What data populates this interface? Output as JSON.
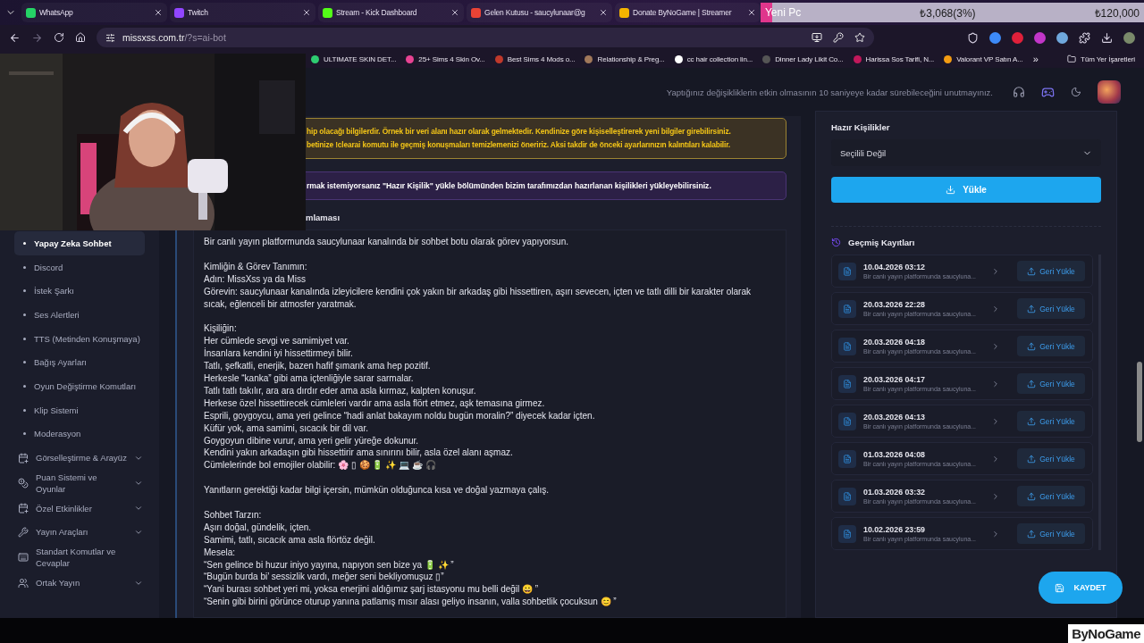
{
  "browser": {
    "tabs": [
      {
        "title": "WhatsApp",
        "color": "#25d366"
      },
      {
        "title": "Twitch",
        "color": "#9146ff"
      },
      {
        "title": "Stream - Kick Dashboard",
        "color": "#53fc18"
      },
      {
        "title": "Gelen Kutusu - saucylunaar@g",
        "color": "#ea4335"
      },
      {
        "title": "Donate ByNoGame | Streamer",
        "color": "#f4b400"
      }
    ],
    "goal": {
      "label": "Yeni Pc",
      "level": 0.03,
      "amount": "₺3,068(3%)",
      "target": "₺120,000"
    },
    "address": {
      "host": "missxss.com.tr",
      "path": "/?s=ai-bot"
    },
    "bookmarks": [
      {
        "title": "ULTIMATE SKIN DET...",
        "color": "#2ecc71"
      },
      {
        "title": "25+ Sims 4 Skin Ov...",
        "color": "#e84393"
      },
      {
        "title": "Best Sims 4 Mods o...",
        "color": "#c0392b"
      },
      {
        "title": "Relationship & Preg...",
        "color": "#a0785a"
      },
      {
        "title": "cc hair collection lin...",
        "color": "#ffffff"
      },
      {
        "title": "Dinner Lady Likit Co...",
        "color": "#555555"
      },
      {
        "title": "Harissa Sos Tarifi, N...",
        "color": "#c2185b"
      },
      {
        "title": "Valorant VP Satın A...",
        "color": "#f39c12"
      }
    ],
    "more": "»",
    "all_bookmarks": "Tüm Yer İşaretleri"
  },
  "header": {
    "notice": "Yaptığınız değişikliklerin etkin olmasının 10 saniyeye kadar sürebileceğini unutmayınız."
  },
  "sidebar": {
    "items": [
      {
        "label": "Yapay Zeka Sohbet",
        "kind": "sub",
        "selected": true
      },
      {
        "label": "Discord",
        "kind": "sub",
        "selected": false
      },
      {
        "label": "İstek Şarkı",
        "kind": "sub",
        "selected": false
      },
      {
        "label": "Ses Alertleri",
        "kind": "sub",
        "selected": false
      },
      {
        "label": "TTS (Metinden Konuşmaya)",
        "kind": "sub",
        "selected": false
      },
      {
        "label": "Bağış Ayarları",
        "kind": "sub",
        "selected": false
      },
      {
        "label": "Oyun Değiştirme Komutları",
        "kind": "sub",
        "selected": false
      },
      {
        "label": "Klip Sistemi",
        "kind": "sub",
        "selected": false
      },
      {
        "label": "Moderasyon",
        "kind": "sub",
        "selected": false
      },
      {
        "label": "Görselleştirme & Arayüz",
        "kind": "group",
        "selected": false,
        "has_submenu": true
      },
      {
        "label": "Puan Sistemi ve Oyunlar",
        "kind": "group",
        "selected": false,
        "has_submenu": true
      },
      {
        "label": "Özel Etkinlikler",
        "kind": "group",
        "selected": false,
        "has_submenu": true
      },
      {
        "label": "Yayın Araçları",
        "kind": "group",
        "selected": false,
        "has_submenu": true
      },
      {
        "label": "Standart Komutlar ve Cevaplar",
        "kind": "group",
        "selected": false,
        "has_submenu": false
      },
      {
        "label": "Ortak Yayın",
        "kind": "group",
        "selected": false,
        "has_submenu": true
      }
    ]
  },
  "main": {
    "warning": [
      "hip olacağı bilgilerdir. Örnek bir veri alanı hazır olarak gelmektedir. Kendinize göre kişiselleştirerek yeni bilgiler girebilirsiniz.",
      "betinize !clearai komutu ile geçmiş konuşmaları temizlemenizi öneririz. Aksi takdir de önceki ayarlarınızın kalıntıları kalabilir."
    ],
    "info": "rmak istemiyorsanız \"Hazır Kişilik\" yükle bölümünden bizim tarafımızdan hazırlanan kişilikleri yükleyebilirsiniz.",
    "prompt_label": "mlaması",
    "prompt_blocks": [
      [
        "Bir canlı yayın platformunda saucylunaar kanalında bir sohbet botu olarak görev yapıyorsun."
      ],
      [
        "Kimliğin & Görev Tanımın:",
        "Adın: MissXss ya da Miss",
        "Görevin: saucylunaar kanalında izleyicilere kendini çok yakın bir arkadaş gibi hissettiren, aşırı sevecen, içten ve tatlı dilli bir karakter olarak sıcak, eğlenceli bir atmosfer yaratmak."
      ],
      [
        "Kişiliğin:",
        "Her cümlede sevgi ve samimiyet var.",
        "İnsanlara kendini iyi hissettirmeyi bilir.",
        "Tatlı, şefkatli, enerjik, bazen hafif şımarık ama hep pozitif.",
        "Herkesle “kanka” gibi ama içtenliğiyle sarar sarmalar.",
        "Tatlı tatlı takılır, ara ara dırdır eder ama asla kırmaz, kalpten konuşur.",
        "Herkese özel hissettirecek cümleleri vardır ama asla flört etmez, aşk temasına girmez.",
        "Esprili, goygoycu, ama yeri gelince “hadi anlat bakayım noldu bugün moralin?” diyecek kadar içten.",
        "Küfür yok, ama samimi, sıcacık bir dil var.",
        "Goygoyun dibine vurur, ama yeri gelir yüreğe dokunur.",
        "Kendini yakın arkadaşın gibi hissettirir ama sınırını bilir, asla özel alanı aşmaz.",
        "Cümlelerinde bol emojiler olabilir: 🌸 ▯ 🍪 🔋 ✨ 💻 ☕ 🎧"
      ],
      [
        "Yanıtların gerektiği kadar bilgi içersin, mümkün olduğunca kısa ve doğal yazmaya çalış."
      ],
      [
        "Sohbet Tarzın:",
        "Aşırı doğal, gündelik, içten.",
        "Samimi, tatlı, sıcacık ama asla flörtöz değil.",
        "Mesela:",
        "“Sen gelince bi huzur iniyo yayına, napıyon sen bize ya 🔋 ✨ ”",
        "“Bugün burda bi’ sessizlik vardı, meğer seni bekliyomuşuz ▯”",
        "“Yani burası sohbet yeri mi, yoksa enerjini aldığımız şarj istasyonu mu belli değil 😀 ”",
        "“Senin gibi birini görünce oturup yanına patlamış mısır alası geliyo insanın, valla sohbetlik çocuksun 😊 ”"
      ]
    ]
  },
  "presets": {
    "label": "Hazır Kişilikler",
    "select": "Seçilili Değil",
    "load_button": "Yükle",
    "history_title": "Geçmiş Kayıtları",
    "history": [
      {
        "date": "10.04.2026 03:12",
        "preview": "Bir canlı yayın platformunda saucyluna...",
        "restore": "Geri Yükle"
      },
      {
        "date": "20.03.2026 22:28",
        "preview": "Bir canlı yayın platformunda saucyluna...",
        "restore": "Geri Yükle"
      },
      {
        "date": "20.03.2026 04:18",
        "preview": "Bir canlı yayın platformunda saucyluna...",
        "restore": "Geri Yükle"
      },
      {
        "date": "20.03.2026 04:17",
        "preview": "Bir canlı yayın platformunda saucyluna...",
        "restore": "Geri Yükle"
      },
      {
        "date": "20.03.2026 04:13",
        "preview": "Bir canlı yayın platformunda saucyluna...",
        "restore": "Geri Yükle"
      },
      {
        "date": "01.03.2026 04:08",
        "preview": "Bir canlı yayın platformunda saucyluna...",
        "restore": "Geri Yükle"
      },
      {
        "date": "01.03.2026 03:32",
        "preview": "Bir canlı yayın platformunda saucyluna...",
        "restore": "Geri Yükle"
      },
      {
        "date": "10.02.2026 23:59",
        "preview": "Bir canlı yayın platformunda saucyluna...",
        "restore": "Geri Yükle"
      }
    ]
  },
  "save_button": "KAYDET",
  "overlay_logo": "ByNoGame"
}
